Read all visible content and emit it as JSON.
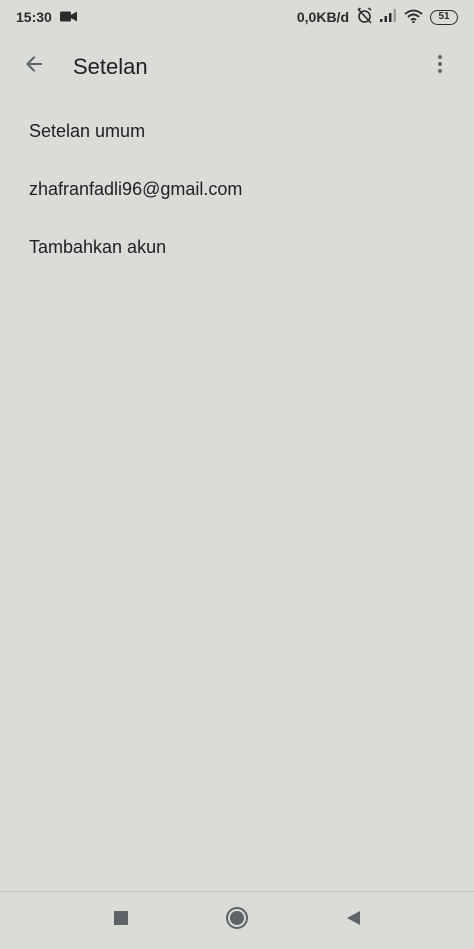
{
  "status_bar": {
    "time": "15:30",
    "video_icon": "video-camera-icon",
    "network_speed": "0,0KB/d",
    "alarm_icon": "alarm-off-icon",
    "signal_icon": "signal-icon",
    "wifi_icon": "wifi-icon",
    "battery_level": "51"
  },
  "app_bar": {
    "back_icon": "arrow-back-icon",
    "title": "Setelan",
    "more_icon": "more-vert-icon"
  },
  "list": {
    "items": [
      {
        "label": "Setelan umum"
      },
      {
        "label": "zhafranfadli96@gmail.com"
      },
      {
        "label": "Tambahkan akun"
      }
    ]
  },
  "nav_bar": {
    "recents_icon": "square-icon",
    "home_icon": "circle-icon",
    "back_icon": "triangle-back-icon"
  },
  "colors": {
    "background": "#d9dcd7",
    "text": "#202124",
    "icon": "#5f6368"
  }
}
